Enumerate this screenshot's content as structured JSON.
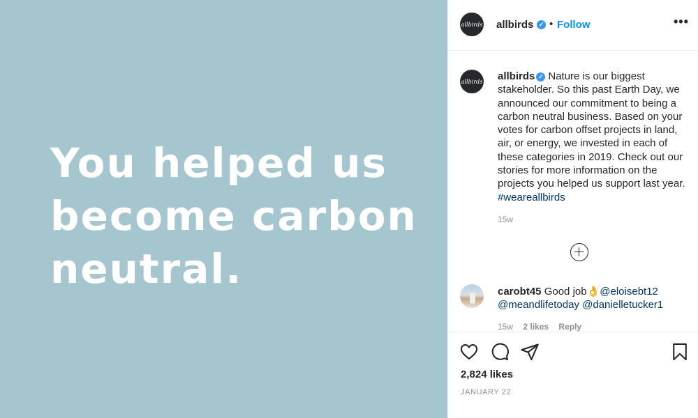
{
  "image": {
    "headline": "You helped us become carbon neutral.",
    "background_color": "#a6c6cf"
  },
  "header": {
    "avatar_text": "allbirds",
    "username": "allbirds",
    "verified_icon": "check",
    "separator": "•",
    "follow_label": "Follow",
    "more_icon": "•••"
  },
  "caption": {
    "avatar_text": "allbirds",
    "username": "allbirds",
    "verified_icon": "check",
    "text": "Nature is our biggest stakeholder. So this past Earth Day, we announced our commitment to being a carbon neutral business. Based on your votes for carbon offset projects in land, air, or energy, we invested in each of these categories in 2019. Check out our stories for more information on the projects you helped us support last year.",
    "hashtag": "#weareallbirds",
    "timestamp": "15w"
  },
  "comment": {
    "username": "carobt45",
    "text": "Good job",
    "emoji": "👌",
    "mentions": [
      "@eloisebt12",
      "@meandlifetoday",
      "@danielletucker1"
    ],
    "time": "15w",
    "likes": "2 likes",
    "reply_label": "Reply"
  },
  "footer": {
    "likes_count": "2,824 likes",
    "date": "JANUARY 22"
  },
  "colors": {
    "accent": "#0095f6",
    "verified": "#3897f0",
    "link": "#00376b",
    "muted": "#8e8e8e"
  }
}
